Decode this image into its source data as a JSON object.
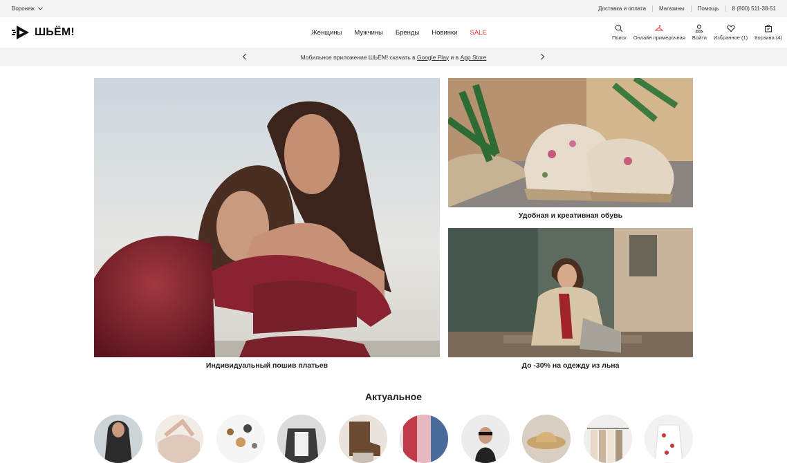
{
  "topbar": {
    "city": "Воронеж",
    "links": [
      "Доставка и оплата",
      "Магазины",
      "Помощь"
    ],
    "phone": "8 (800) 511-38-51"
  },
  "header": {
    "logo_text": "ШЬЁМ!",
    "nav": [
      "Женщины",
      "Мужчины",
      "Бренды",
      "Новинки"
    ],
    "sale": "SALE",
    "tools": {
      "search": "Поиск",
      "fitting": "Онлайн примерочная",
      "login": "Войти",
      "favorites": "Избранное (1)",
      "cart": "Корзина (4)"
    }
  },
  "promo": {
    "text_before": "Мобильное приложение ШЬЁМ! скачать в ",
    "google": "Google Play",
    "text_mid": " и в ",
    "apple": "App Store"
  },
  "banners": {
    "big_caption": "Индивидуальный пошив платьев",
    "shoes_caption": "Удобная и креативная обувь",
    "linen_caption": "До -30% на одежду из льна"
  },
  "actual": {
    "title": "Актуальное"
  },
  "colors": {
    "accent_red": "#e0342d",
    "bar_bg": "#f3f3f3"
  }
}
